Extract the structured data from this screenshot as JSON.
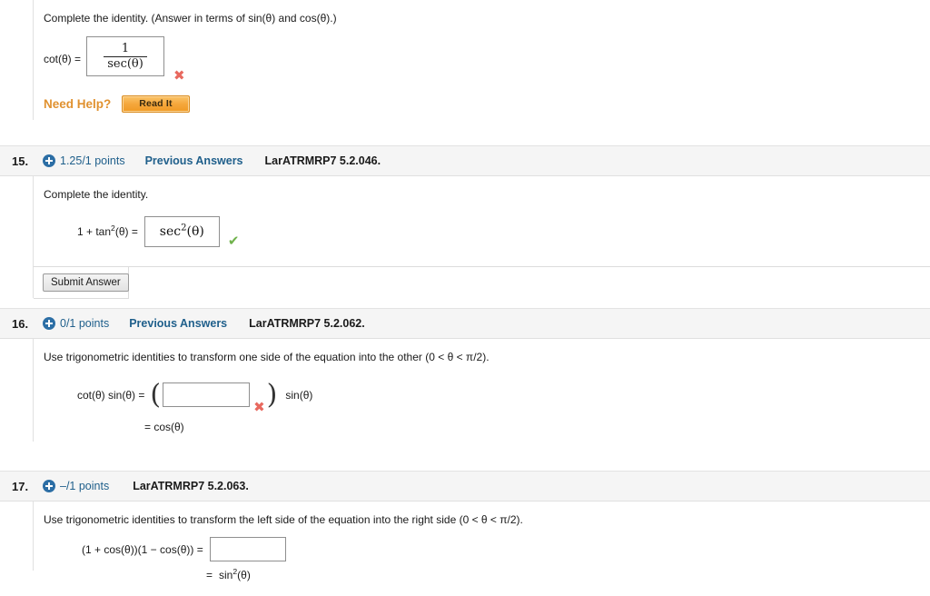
{
  "icons": {
    "plus": "plus-circle-icon",
    "cross": "✖",
    "check": "✔"
  },
  "questions": [
    {
      "id": "q14",
      "header_visible": false,
      "prompt": "Complete the identity. (Answer in terms of sin(θ) and cos(θ).)",
      "equation": {
        "lhs": "cot(θ) =",
        "answer_numerator": "1",
        "answer_denominator": "sec(θ)"
      },
      "grade_mark": "✖",
      "grade_mark_color": "#e8695f",
      "need_help": {
        "label": "Need Help?",
        "button_label": "Read It"
      }
    },
    {
      "id": "q15",
      "number": "15.",
      "points": "1.25/1 points",
      "previous_answers": "Previous Answers",
      "reference": "LarATRMRP7 5.2.046.",
      "prompt": "Complete the identity.",
      "equation": {
        "lhs_pre": "1 + tan",
        "lhs_sup": "2",
        "lhs_post": "(θ) =",
        "answer_base": "sec",
        "answer_sup": "2",
        "answer_arg": "(θ)"
      },
      "grade_mark": "✔",
      "grade_mark_color": "#6fb24b",
      "submit_label": "Submit Answer"
    },
    {
      "id": "q16",
      "number": "16.",
      "points": "0/1 points",
      "previous_answers": "Previous Answers",
      "reference": "LarATRMRP7 5.2.062.",
      "prompt": "Use trigonometric identities to transform one side of the equation into the other (0 < θ < π/2).",
      "equation": {
        "lhs": "cot(θ) sin(θ) =",
        "paren_open": "(",
        "answer_value": "",
        "paren_close": ")",
        "trailing": "sin(θ)",
        "second_line": "= cos(θ)"
      },
      "grade_mark": "✖",
      "grade_mark_color": "#e8695f"
    },
    {
      "id": "q17",
      "number": "17.",
      "points": "–/1 points",
      "previous_answers": "",
      "reference": "LarATRMRP7 5.2.063.",
      "prompt": "Use trigonometric identities to transform the left side of the equation into the right side (0 < θ < π/2).",
      "equation": {
        "lhs": "(1 + cos(θ))(1 − cos(θ))  =",
        "answer_value": "",
        "second_line_eq": "=",
        "second_line_base": "sin",
        "second_line_sup": "2",
        "second_line_arg": "(θ)"
      }
    }
  ]
}
